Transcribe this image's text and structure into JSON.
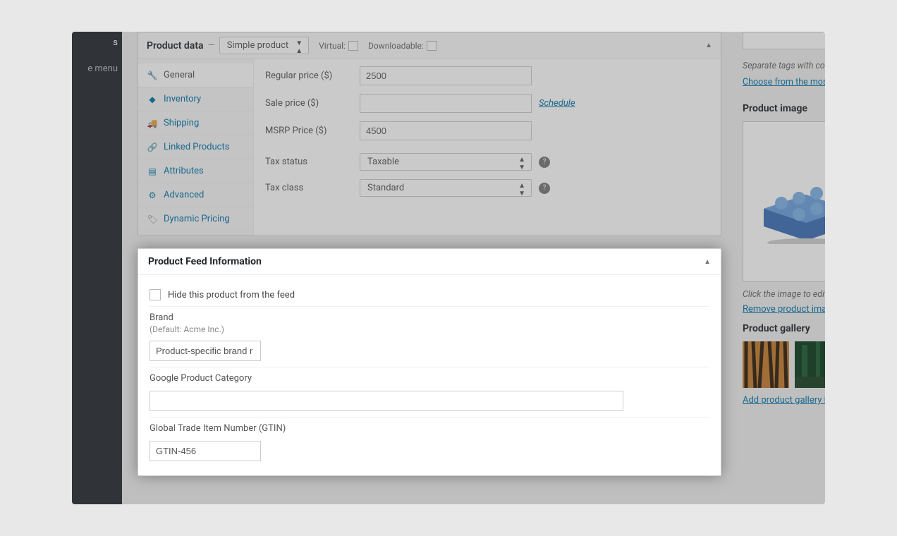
{
  "sidebar": {
    "item_a": "s",
    "item_b": "e menu"
  },
  "product_data": {
    "title": "Product data",
    "type_select": "Simple product",
    "virtual_label": "Virtual:",
    "downloadable_label": "Downloadable:",
    "tabs": {
      "general": "General",
      "inventory": "Inventory",
      "shipping": "Shipping",
      "linked": "Linked Products",
      "attributes": "Attributes",
      "advanced": "Advanced",
      "dynamic": "Dynamic Pricing"
    },
    "fields": {
      "regular_price_label": "Regular price ($)",
      "regular_price_value": "2500",
      "sale_price_label": "Sale price ($)",
      "sale_price_value": "",
      "schedule_link": "Schedule",
      "msrp_label": "MSRP Price ($)",
      "msrp_value": "4500",
      "tax_status_label": "Tax status",
      "tax_status_value": "Taxable",
      "tax_class_label": "Tax class",
      "tax_class_value": "Standard"
    }
  },
  "feed": {
    "title": "Product Feed Information",
    "hide_label": "Hide this product from the feed",
    "brand_label": "Brand",
    "brand_default": "(Default: Acme Inc.)",
    "brand_value": "Product-specific brand r",
    "google_cat_label": "Google Product Category",
    "google_cat_value": "",
    "gtin_label": "Global Trade Item Number (GTIN)",
    "gtin_value": "GTIN-456"
  },
  "tags": {
    "hint": "Separate tags with con",
    "choose_link": "Choose from the most"
  },
  "product_image": {
    "title": "Product image",
    "caption": "Click the image to edit",
    "remove_link": "Remove product image"
  },
  "gallery": {
    "title": "Product gallery",
    "add_link": "Add product gallery im"
  }
}
